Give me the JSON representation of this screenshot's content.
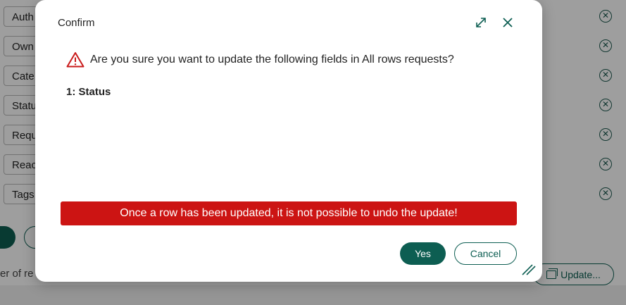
{
  "background": {
    "fields": [
      "Auth",
      "Own",
      "Cate",
      "Statu",
      "Requ",
      "Reac",
      "Tags"
    ],
    "remove_icon": "circle-x-icon",
    "footer_text": "er of re",
    "update_button_label": "Update..."
  },
  "dialog": {
    "title": "Confirm",
    "question": "Are you sure you want to update the following fields in All rows requests?",
    "fields_list": [
      "1: Status"
    ],
    "warning_banner": "Once a row has been updated, it is not possible to undo the update!",
    "yes_label": "Yes",
    "cancel_label": "Cancel",
    "icons": {
      "expand": "expand-icon",
      "close": "close-icon",
      "warning": "warning-triangle-icon",
      "resize": "resize-handle-icon"
    }
  },
  "colors": {
    "accent": "#0d5e52",
    "danger": "#cc1413",
    "warning_icon": "#c91a1a"
  }
}
